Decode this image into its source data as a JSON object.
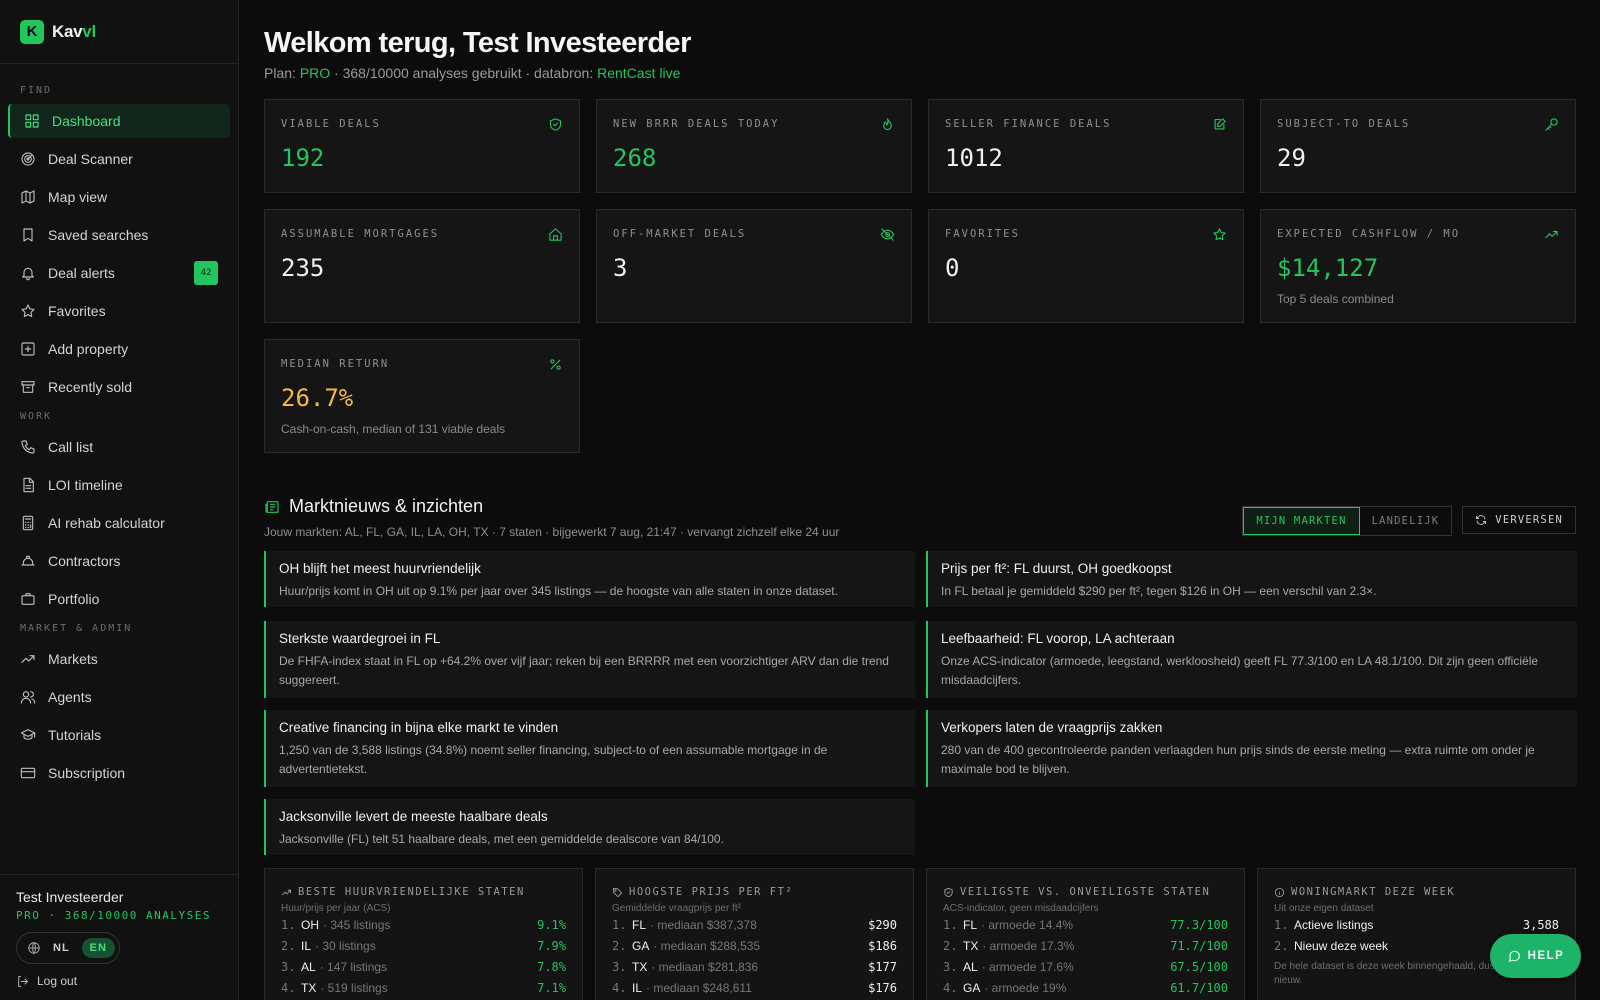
{
  "brand": {
    "name_a": "Kav",
    "name_b": "vl",
    "logo_letter": "K",
    "accent": "#22c55e"
  },
  "sidebar": {
    "sections": {
      "find": "FIND",
      "work": "WORK",
      "market": "MARKET & ADMIN"
    },
    "items": [
      {
        "label": "Dashboard",
        "icon": "dashboard-icon"
      },
      {
        "label": "Deal Scanner",
        "icon": "radar-icon"
      },
      {
        "label": "Map view",
        "icon": "map-icon"
      },
      {
        "label": "Saved searches",
        "icon": "bookmark-icon"
      },
      {
        "label": "Deal alerts",
        "icon": "bell-icon",
        "badge": "42"
      },
      {
        "label": "Favorites",
        "icon": "star-icon"
      },
      {
        "label": "Add property",
        "icon": "plus-square-icon"
      },
      {
        "label": "Recently sold",
        "icon": "archive-icon"
      },
      {
        "label": "Call list",
        "icon": "phone-icon"
      },
      {
        "label": "LOI timeline",
        "icon": "document-icon"
      },
      {
        "label": "AI rehab calculator",
        "icon": "calculator-icon"
      },
      {
        "label": "Contractors",
        "icon": "hardhat-icon"
      },
      {
        "label": "Portfolio",
        "icon": "briefcase-icon"
      },
      {
        "label": "Markets",
        "icon": "trending-up-icon"
      },
      {
        "label": "Agents",
        "icon": "users-icon"
      },
      {
        "label": "Tutorials",
        "icon": "graduation-cap-icon"
      },
      {
        "label": "Subscription",
        "icon": "credit-card-icon"
      }
    ]
  },
  "user": {
    "name": "Test Investeerder",
    "plan": "PRO · 368/10000 ANALYSES",
    "lang_nl": "NL",
    "lang_en": "EN",
    "logout": "Log out"
  },
  "header": {
    "title": "Welkom terug, Test Investeerder",
    "plan_prefix": "Plan: ",
    "plan": "PRO",
    "usage": " · 368/10000 analyses gebruikt · databron: ",
    "source": "RentCast live"
  },
  "cards": [
    {
      "label": "VIABLE DEALS",
      "value": "192",
      "icon": "shield-check-icon",
      "color": "green"
    },
    {
      "label": "NEW BRRR DEALS TODAY",
      "value": "268",
      "icon": "flame-icon",
      "color": "green"
    },
    {
      "label": "SELLER FINANCE DEALS",
      "value": "1012",
      "icon": "edit-icon",
      "color": "white"
    },
    {
      "label": "SUBJECT-TO DEALS",
      "value": "29",
      "icon": "key-icon",
      "color": "white"
    },
    {
      "label": "ASSUMABLE MORTGAGES",
      "value": "235",
      "icon": "home-icon",
      "color": "white"
    },
    {
      "label": "OFF-MARKET DEALS",
      "value": "3",
      "icon": "eye-off-icon",
      "color": "white"
    },
    {
      "label": "FAVORITES",
      "value": "0",
      "icon": "star-icon",
      "color": "white"
    },
    {
      "label": "EXPECTED CASHFLOW / MO",
      "value": "$14,127",
      "note": "Top 5 deals combined",
      "icon": "trending-up-icon",
      "color": "green"
    },
    {
      "label": "MEDIAN RETURN",
      "value": "26.7%",
      "note": "Cash-on-cash, median of 131 viable deals",
      "icon": "percent-icon",
      "color": "yellow"
    }
  ],
  "news": {
    "title": "Marktnieuws & inzichten",
    "subtitle": "Jouw markten: AL, FL, GA, IL, LA, OH, TX · 7 staten · bijgewerkt 7 aug, 21:47 · vervangt zichzelf elke 24 uur",
    "tab_mine": "MIJN MARKTEN",
    "tab_national": "LANDELIJK",
    "refresh": "VERVERSEN",
    "items": [
      {
        "h": "OH blijft het meest huurvriendelijk",
        "b": "Huur/prijs komt in OH uit op 9.1% per jaar over 345 listings — de hoogste van alle staten in onze dataset."
      },
      {
        "h": "Prijs per ft²: FL duurst, OH goedkoopst",
        "b": "In FL betaal je gemiddeld $290 per ft², tegen $126 in OH — een verschil van 2.3×."
      },
      {
        "h": "Sterkste waardegroei in FL",
        "b": "De FHFA-index staat in FL op +64.2% over vijf jaar; reken bij een BRRRR met een voorzichtiger ARV dan die trend suggereert."
      },
      {
        "h": "Leefbaarheid: FL voorop, LA achteraan",
        "b": "Onze ACS-indicator (armoede, leegstand, werkloosheid) geeft FL 77.3/100 en LA 48.1/100. Dit zijn geen officiële misdaadcijfers."
      },
      {
        "h": "Creative financing in bijna elke markt te vinden",
        "b": "1,250 van de 3,588 listings (34.8%) noemt seller financing, subject-to of een assumable mortgage in de advertentietekst."
      },
      {
        "h": "Verkopers laten de vraagprijs zakken",
        "b": "280 van de 400 gecontroleerde panden verlaagden hun prijs sinds de eerste meting — extra ruimte om onder je maximale bod te blijven."
      },
      {
        "h": "Jacksonville levert de meeste haalbare deals",
        "b": "Jacksonville (FL) telt 51 haalbare deals, met een gemiddelde dealscore van 84/100."
      }
    ]
  },
  "panels": [
    {
      "title": "BESTE HUURVRIENDELIJKE STATEN",
      "sub": "Huur/prijs per jaar (ACS)",
      "icon": "trending-up-icon",
      "rows": [
        {
          "n": "1.",
          "k": "OH",
          "d": "· 345 listings",
          "v": "9.1%"
        },
        {
          "n": "2.",
          "k": "IL",
          "d": "· 30 listings",
          "v": "7.9%"
        },
        {
          "n": "3.",
          "k": "AL",
          "d": "· 147 listings",
          "v": "7.8%"
        },
        {
          "n": "4.",
          "k": "TX",
          "d": "· 519 listings",
          "v": "7.1%"
        }
      ]
    },
    {
      "title": "HOOGSTE PRIJS PER FT²",
      "sub": "Gemiddelde vraagprijs per ft²",
      "icon": "tag-icon",
      "rows": [
        {
          "n": "1.",
          "k": "FL",
          "d": "· mediaan $387,378",
          "v": "$290"
        },
        {
          "n": "2.",
          "k": "GA",
          "d": "· mediaan $288,535",
          "v": "$186"
        },
        {
          "n": "3.",
          "k": "TX",
          "d": "· mediaan $281,836",
          "v": "$177"
        },
        {
          "n": "4.",
          "k": "IL",
          "d": "· mediaan $248,611",
          "v": "$176"
        }
      ]
    },
    {
      "title": "VEILIGSTE VS. ONVEILIGSTE STATEN",
      "sub": "ACS-indicator, geen misdaadcijfers",
      "icon": "shield-icon",
      "rows": [
        {
          "n": "1.",
          "k": "FL",
          "d": "· armoede 14.4%",
          "v": "77.3/100"
        },
        {
          "n": "2.",
          "k": "TX",
          "d": "· armoede 17.3%",
          "v": "71.7/100"
        },
        {
          "n": "3.",
          "k": "AL",
          "d": "· armoede 17.6%",
          "v": "67.5/100"
        },
        {
          "n": "4.",
          "k": "GA",
          "d": "· armoede 19%",
          "v": "61.7/100"
        }
      ]
    },
    {
      "title": "WONINGMARKT DEZE WEEK",
      "sub": "Uit onze eigen dataset",
      "icon": "info-icon",
      "rows": [
        {
          "n": "1.",
          "k": "Actieve listings",
          "d": "",
          "v": "3,588"
        },
        {
          "n": "2.",
          "k": "Nieuw deze week",
          "d": "",
          "v": ""
        }
      ],
      "footnote": "De hele dataset is deze week binnengehaald, dus … telt als nieuw."
    }
  ],
  "help": "HELP"
}
